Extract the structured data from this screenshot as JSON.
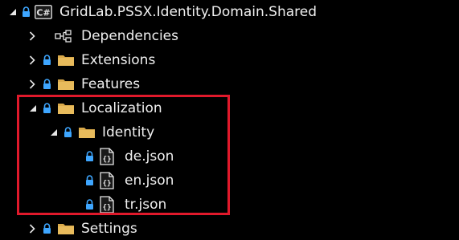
{
  "colors": {
    "background": "#000000",
    "text": "#f0f0f0",
    "lock": "#3ea6ff",
    "folder": "#d9a94a",
    "highlight": "#e0192b"
  },
  "tree": {
    "project": {
      "label": "GridLab.PSSX.Identity.Domain.Shared",
      "badge": "C#",
      "expanded": true
    },
    "dependencies": {
      "label": "Dependencies",
      "expanded": false
    },
    "extensions": {
      "label": "Extensions",
      "expanded": false
    },
    "features": {
      "label": "Features",
      "expanded": false
    },
    "localization": {
      "label": "Localization",
      "expanded": true
    },
    "identity": {
      "label": "Identity",
      "expanded": true
    },
    "files": [
      {
        "label": "de.json",
        "glyph": "{}"
      },
      {
        "label": "en.json",
        "glyph": "{}"
      },
      {
        "label": "tr.json",
        "glyph": "{}"
      }
    ],
    "settings": {
      "label": "Settings",
      "expanded": false
    }
  }
}
